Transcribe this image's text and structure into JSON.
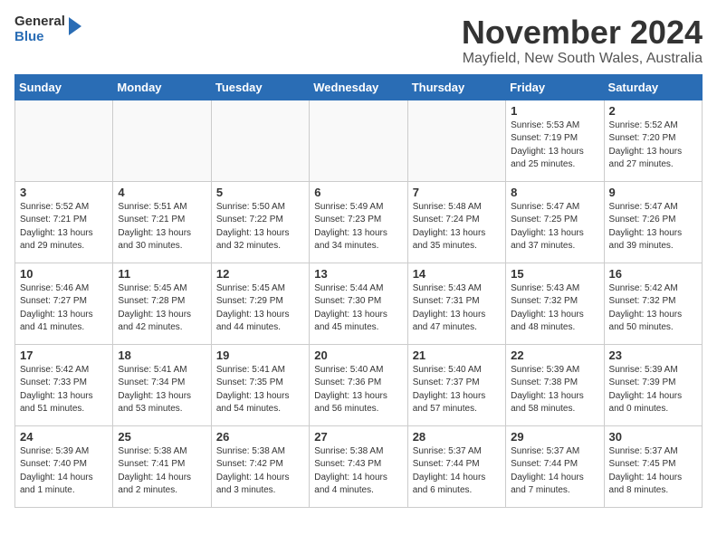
{
  "logo": {
    "general": "General",
    "blue": "Blue"
  },
  "title": "November 2024",
  "location": "Mayfield, New South Wales, Australia",
  "weekdays": [
    "Sunday",
    "Monday",
    "Tuesday",
    "Wednesday",
    "Thursday",
    "Friday",
    "Saturday"
  ],
  "weeks": [
    [
      {
        "day": "",
        "info": ""
      },
      {
        "day": "",
        "info": ""
      },
      {
        "day": "",
        "info": ""
      },
      {
        "day": "",
        "info": ""
      },
      {
        "day": "",
        "info": ""
      },
      {
        "day": "1",
        "info": "Sunrise: 5:53 AM\nSunset: 7:19 PM\nDaylight: 13 hours\nand 25 minutes."
      },
      {
        "day": "2",
        "info": "Sunrise: 5:52 AM\nSunset: 7:20 PM\nDaylight: 13 hours\nand 27 minutes."
      }
    ],
    [
      {
        "day": "3",
        "info": "Sunrise: 5:52 AM\nSunset: 7:21 PM\nDaylight: 13 hours\nand 29 minutes."
      },
      {
        "day": "4",
        "info": "Sunrise: 5:51 AM\nSunset: 7:21 PM\nDaylight: 13 hours\nand 30 minutes."
      },
      {
        "day": "5",
        "info": "Sunrise: 5:50 AM\nSunset: 7:22 PM\nDaylight: 13 hours\nand 32 minutes."
      },
      {
        "day": "6",
        "info": "Sunrise: 5:49 AM\nSunset: 7:23 PM\nDaylight: 13 hours\nand 34 minutes."
      },
      {
        "day": "7",
        "info": "Sunrise: 5:48 AM\nSunset: 7:24 PM\nDaylight: 13 hours\nand 35 minutes."
      },
      {
        "day": "8",
        "info": "Sunrise: 5:47 AM\nSunset: 7:25 PM\nDaylight: 13 hours\nand 37 minutes."
      },
      {
        "day": "9",
        "info": "Sunrise: 5:47 AM\nSunset: 7:26 PM\nDaylight: 13 hours\nand 39 minutes."
      }
    ],
    [
      {
        "day": "10",
        "info": "Sunrise: 5:46 AM\nSunset: 7:27 PM\nDaylight: 13 hours\nand 41 minutes."
      },
      {
        "day": "11",
        "info": "Sunrise: 5:45 AM\nSunset: 7:28 PM\nDaylight: 13 hours\nand 42 minutes."
      },
      {
        "day": "12",
        "info": "Sunrise: 5:45 AM\nSunset: 7:29 PM\nDaylight: 13 hours\nand 44 minutes."
      },
      {
        "day": "13",
        "info": "Sunrise: 5:44 AM\nSunset: 7:30 PM\nDaylight: 13 hours\nand 45 minutes."
      },
      {
        "day": "14",
        "info": "Sunrise: 5:43 AM\nSunset: 7:31 PM\nDaylight: 13 hours\nand 47 minutes."
      },
      {
        "day": "15",
        "info": "Sunrise: 5:43 AM\nSunset: 7:32 PM\nDaylight: 13 hours\nand 48 minutes."
      },
      {
        "day": "16",
        "info": "Sunrise: 5:42 AM\nSunset: 7:32 PM\nDaylight: 13 hours\nand 50 minutes."
      }
    ],
    [
      {
        "day": "17",
        "info": "Sunrise: 5:42 AM\nSunset: 7:33 PM\nDaylight: 13 hours\nand 51 minutes."
      },
      {
        "day": "18",
        "info": "Sunrise: 5:41 AM\nSunset: 7:34 PM\nDaylight: 13 hours\nand 53 minutes."
      },
      {
        "day": "19",
        "info": "Sunrise: 5:41 AM\nSunset: 7:35 PM\nDaylight: 13 hours\nand 54 minutes."
      },
      {
        "day": "20",
        "info": "Sunrise: 5:40 AM\nSunset: 7:36 PM\nDaylight: 13 hours\nand 56 minutes."
      },
      {
        "day": "21",
        "info": "Sunrise: 5:40 AM\nSunset: 7:37 PM\nDaylight: 13 hours\nand 57 minutes."
      },
      {
        "day": "22",
        "info": "Sunrise: 5:39 AM\nSunset: 7:38 PM\nDaylight: 13 hours\nand 58 minutes."
      },
      {
        "day": "23",
        "info": "Sunrise: 5:39 AM\nSunset: 7:39 PM\nDaylight: 14 hours\nand 0 minutes."
      }
    ],
    [
      {
        "day": "24",
        "info": "Sunrise: 5:39 AM\nSunset: 7:40 PM\nDaylight: 14 hours\nand 1 minute."
      },
      {
        "day": "25",
        "info": "Sunrise: 5:38 AM\nSunset: 7:41 PM\nDaylight: 14 hours\nand 2 minutes."
      },
      {
        "day": "26",
        "info": "Sunrise: 5:38 AM\nSunset: 7:42 PM\nDaylight: 14 hours\nand 3 minutes."
      },
      {
        "day": "27",
        "info": "Sunrise: 5:38 AM\nSunset: 7:43 PM\nDaylight: 14 hours\nand 4 minutes."
      },
      {
        "day": "28",
        "info": "Sunrise: 5:37 AM\nSunset: 7:44 PM\nDaylight: 14 hours\nand 6 minutes."
      },
      {
        "day": "29",
        "info": "Sunrise: 5:37 AM\nSunset: 7:44 PM\nDaylight: 14 hours\nand 7 minutes."
      },
      {
        "day": "30",
        "info": "Sunrise: 5:37 AM\nSunset: 7:45 PM\nDaylight: 14 hours\nand 8 minutes."
      }
    ]
  ]
}
